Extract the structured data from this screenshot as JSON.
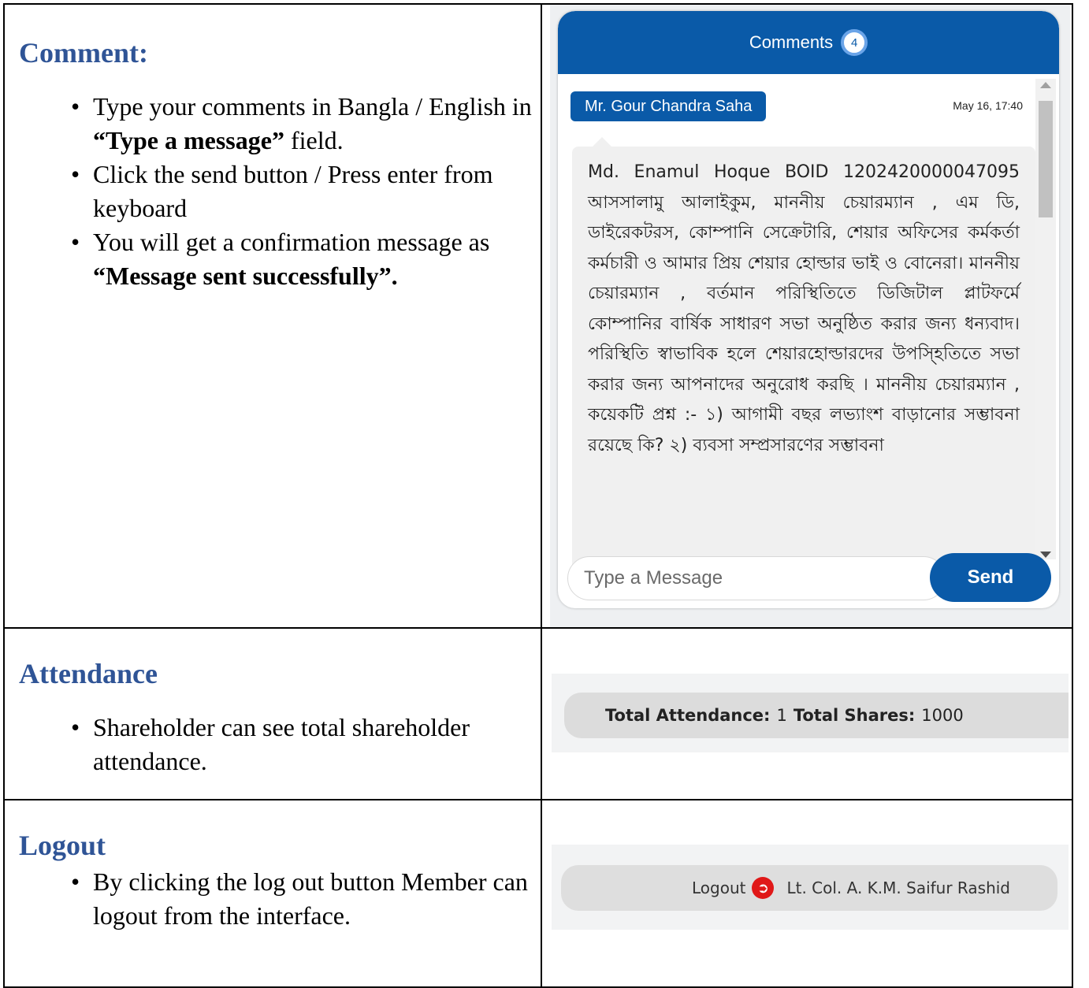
{
  "comment": {
    "title": "Comment:",
    "bullets": {
      "b1_pre": "Type your comments in Bangla / English in ",
      "b1_bold": "“Type a message”",
      "b1_post": " field.",
      "b2": "Click the send button / Press enter from keyboard",
      "b3_pre": "You will get a confirmation message as ",
      "b3_bold": "“Message sent successfully”."
    }
  },
  "chat": {
    "header_label": "Comments",
    "count": "4",
    "author": "Mr. Gour Chandra Saha",
    "time": "May 16, 17:40",
    "message": "Md. Enamul Hoque BOID 1202420000047095 আসসালামু আলাইকুম, মাননীয় চেয়ারম্যান , এম ডি, ডাইরেকটরস, কোম্পানি সেক্রেটারি, শেয়ার অফিসের কর্মকর্তা কর্মচারী ও আমার প্রিয় শেয়ার হোল্ডার ভাই ও বোনেরা। মাননীয় চেয়ারম্যান , বর্তমান পরিস্থিতিতে ডিজিটাল প্লাটফর্মে কোম্পানির বার্ষিক সাধারণ সভা অনুষ্ঠিত করার জন্য ধন্যবাদ। পরিস্থিতি স্বাভাবিক হলে শেয়ারহোল্ডারদের উপস্হিতিতে সভা করার জন্য আপনাদের অনুরোধ করছি । মাননীয় চেয়ারম্যান , কয়েকটি প্রশ্ন :- ১) আগামী বছর লভ্যাংশ বাড়ানোর সম্ভাবনা রয়েছে কি? ২) ব্যবসা সম্প্রসারণের সম্ভাবনা",
    "input_placeholder": "Type a Message",
    "send_label": "Send"
  },
  "attendance": {
    "title": "Attendance",
    "bullet": "Shareholder can see total shareholder attendance.",
    "total_attendance_label": "Total Attendance:",
    "total_attendance_value": "1",
    "total_shares_label": "Total Shares:",
    "total_shares_value": "1000"
  },
  "logout": {
    "title": "Logout",
    "bullet": "By clicking the log out button Member can logout from the interface.",
    "logout_label": "Logout",
    "user_name": "Lt. Col. A. K.M. Saifur Rashid",
    "icon": "logout-icon",
    "icon_color": "#e01818"
  },
  "colors": {
    "heading": "#2f5496",
    "brand_blue": "#0a5aa8"
  }
}
